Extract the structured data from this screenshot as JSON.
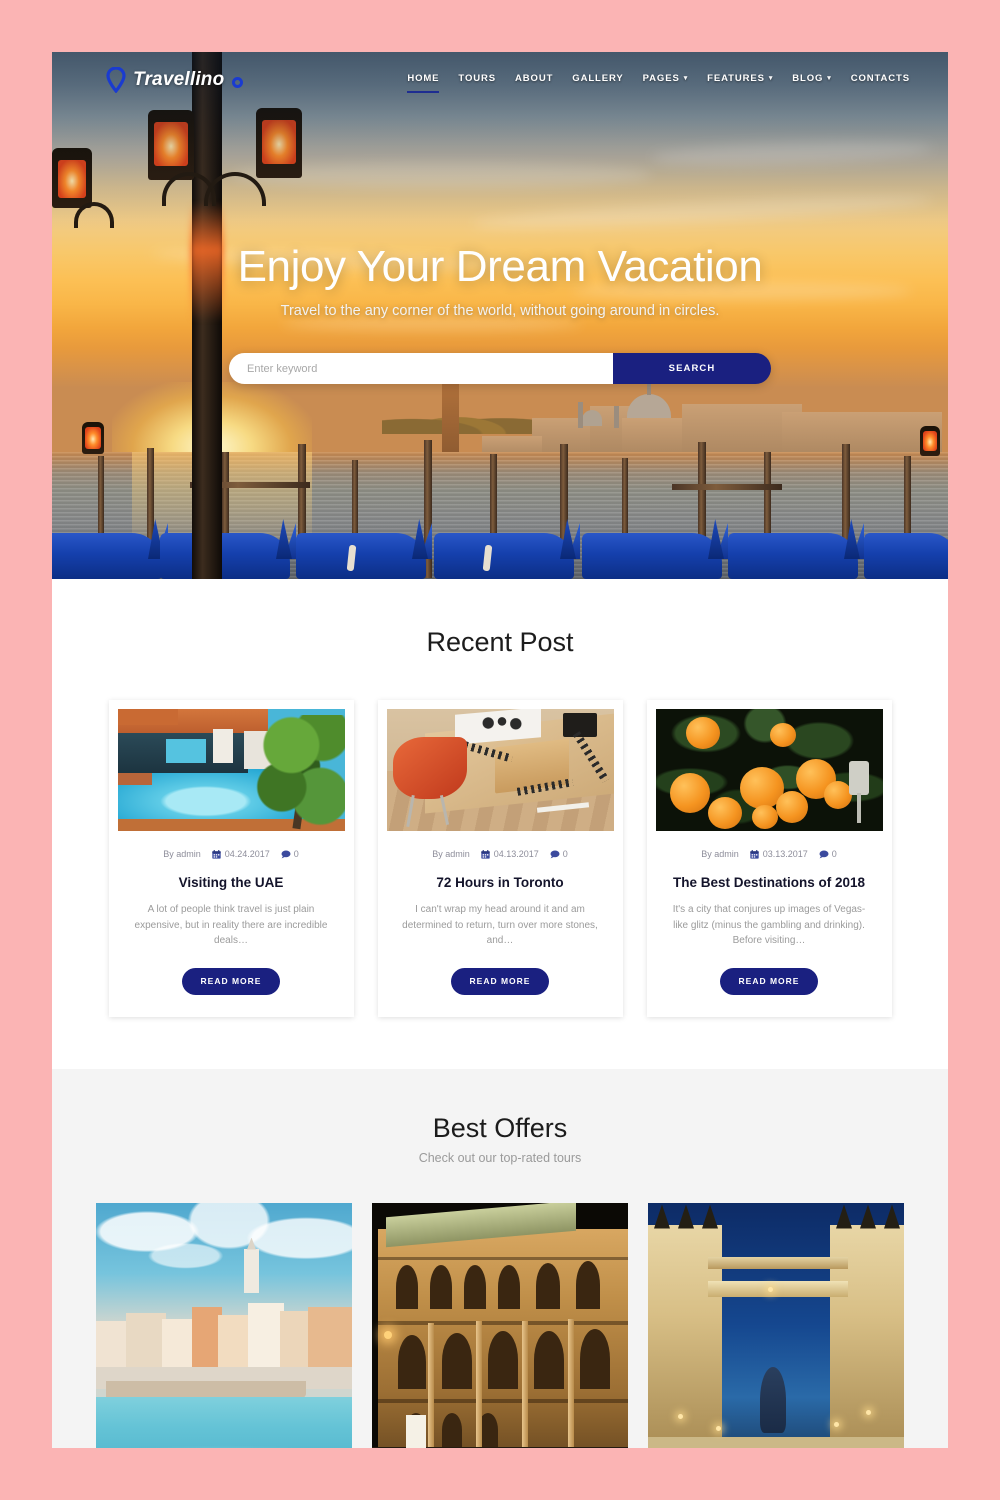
{
  "site": {
    "logo_text": "Travellino",
    "logo_icon": "map-pin-icon"
  },
  "nav": {
    "items": [
      {
        "label": "HOME",
        "active": true,
        "has_dropdown": false
      },
      {
        "label": "TOURS",
        "active": false,
        "has_dropdown": false
      },
      {
        "label": "ABOUT",
        "active": false,
        "has_dropdown": false
      },
      {
        "label": "GALLERY",
        "active": false,
        "has_dropdown": false
      },
      {
        "label": "PAGES",
        "active": false,
        "has_dropdown": true
      },
      {
        "label": "FEATURES",
        "active": false,
        "has_dropdown": true
      },
      {
        "label": "BLOG",
        "active": false,
        "has_dropdown": true
      },
      {
        "label": "CONTACTS",
        "active": false,
        "has_dropdown": false
      }
    ],
    "caret_glyph": "▾"
  },
  "hero": {
    "title": "Enjoy Your Dream Vacation",
    "subtitle": "Travel to the any corner of the world, without going around in circles.",
    "search_placeholder": "Enter keyword",
    "search_value": "",
    "search_button": "SEARCH",
    "image_description": "Venice sunset with gondolas and street lamp"
  },
  "recent_post": {
    "title": "Recent Post",
    "cards": [
      {
        "author_prefix": "By",
        "author": "admin",
        "date": "04.24.2017",
        "comments": "0",
        "title": "Visiting the UAE",
        "excerpt": "A lot of people think travel is just plain expensive, but in reality there are incredible deals…",
        "button": "READ MORE",
        "image_description": "Resort swimming pool seen from above"
      },
      {
        "author_prefix": "By",
        "author": "admin",
        "date": "04.13.2017",
        "comments": "0",
        "title": "72 Hours in Toronto",
        "excerpt": "I can't wrap my head around it and am determined to return, turn over more stones, and…",
        "button": "READ MORE",
        "image_description": "Orange chair at a wooden desk with notebooks"
      },
      {
        "author_prefix": "By",
        "author": "admin",
        "date": "03.13.2017",
        "comments": "0",
        "title": "The Best Destinations of 2018",
        "excerpt": "It's a city that conjures up images of Vegas-like glitz (minus the gambling and drinking). Before visiting…",
        "button": "READ MORE",
        "image_description": "Oranges ripening on a tree"
      }
    ],
    "icons": {
      "date": "calendar-icon",
      "comments": "comment-icon"
    }
  },
  "best_offers": {
    "title": "Best Offers",
    "subtitle": "Check out our top-rated tours",
    "offers": [
      {
        "image_description": "Mediterranean coastal town with turquoise sea"
      },
      {
        "image_description": "Illuminated opera house at night"
      },
      {
        "image_description": "Tower Bridge in London at dusk"
      }
    ]
  },
  "colors": {
    "page_border": "#fbb4b4",
    "accent_blue": "#1a2080",
    "section_gray": "#f4f4f4",
    "heading": "#1c1c1c",
    "muted_text": "#9b9b9b"
  }
}
